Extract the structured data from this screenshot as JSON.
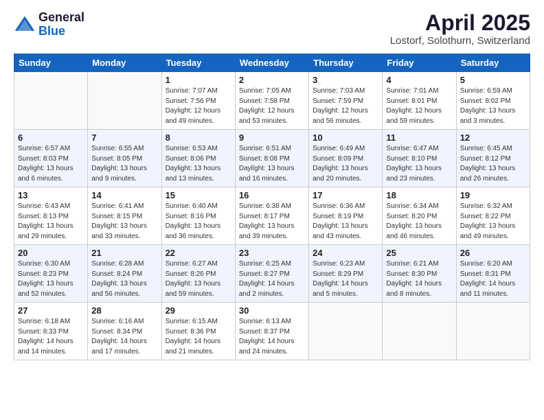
{
  "header": {
    "logo_general": "General",
    "logo_blue": "Blue",
    "month_title": "April 2025",
    "location": "Lostorf, Solothurn, Switzerland"
  },
  "weekdays": [
    "Sunday",
    "Monday",
    "Tuesday",
    "Wednesday",
    "Thursday",
    "Friday",
    "Saturday"
  ],
  "weeks": [
    [
      {
        "day": "",
        "info": ""
      },
      {
        "day": "",
        "info": ""
      },
      {
        "day": "1",
        "info": "Sunrise: 7:07 AM\nSunset: 7:56 PM\nDaylight: 12 hours and 49 minutes."
      },
      {
        "day": "2",
        "info": "Sunrise: 7:05 AM\nSunset: 7:58 PM\nDaylight: 12 hours and 53 minutes."
      },
      {
        "day": "3",
        "info": "Sunrise: 7:03 AM\nSunset: 7:59 PM\nDaylight: 12 hours and 56 minutes."
      },
      {
        "day": "4",
        "info": "Sunrise: 7:01 AM\nSunset: 8:01 PM\nDaylight: 12 hours and 59 minutes."
      },
      {
        "day": "5",
        "info": "Sunrise: 6:59 AM\nSunset: 8:02 PM\nDaylight: 13 hours and 3 minutes."
      }
    ],
    [
      {
        "day": "6",
        "info": "Sunrise: 6:57 AM\nSunset: 8:03 PM\nDaylight: 13 hours and 6 minutes."
      },
      {
        "day": "7",
        "info": "Sunrise: 6:55 AM\nSunset: 8:05 PM\nDaylight: 13 hours and 9 minutes."
      },
      {
        "day": "8",
        "info": "Sunrise: 6:53 AM\nSunset: 8:06 PM\nDaylight: 13 hours and 13 minutes."
      },
      {
        "day": "9",
        "info": "Sunrise: 6:51 AM\nSunset: 8:08 PM\nDaylight: 13 hours and 16 minutes."
      },
      {
        "day": "10",
        "info": "Sunrise: 6:49 AM\nSunset: 8:09 PM\nDaylight: 13 hours and 20 minutes."
      },
      {
        "day": "11",
        "info": "Sunrise: 6:47 AM\nSunset: 8:10 PM\nDaylight: 13 hours and 23 minutes."
      },
      {
        "day": "12",
        "info": "Sunrise: 6:45 AM\nSunset: 8:12 PM\nDaylight: 13 hours and 26 minutes."
      }
    ],
    [
      {
        "day": "13",
        "info": "Sunrise: 6:43 AM\nSunset: 8:13 PM\nDaylight: 13 hours and 29 minutes."
      },
      {
        "day": "14",
        "info": "Sunrise: 6:41 AM\nSunset: 8:15 PM\nDaylight: 13 hours and 33 minutes."
      },
      {
        "day": "15",
        "info": "Sunrise: 6:40 AM\nSunset: 8:16 PM\nDaylight: 13 hours and 36 minutes."
      },
      {
        "day": "16",
        "info": "Sunrise: 6:38 AM\nSunset: 8:17 PM\nDaylight: 13 hours and 39 minutes."
      },
      {
        "day": "17",
        "info": "Sunrise: 6:36 AM\nSunset: 8:19 PM\nDaylight: 13 hours and 43 minutes."
      },
      {
        "day": "18",
        "info": "Sunrise: 6:34 AM\nSunset: 8:20 PM\nDaylight: 13 hours and 46 minutes."
      },
      {
        "day": "19",
        "info": "Sunrise: 6:32 AM\nSunset: 8:22 PM\nDaylight: 13 hours and 49 minutes."
      }
    ],
    [
      {
        "day": "20",
        "info": "Sunrise: 6:30 AM\nSunset: 8:23 PM\nDaylight: 13 hours and 52 minutes."
      },
      {
        "day": "21",
        "info": "Sunrise: 6:28 AM\nSunset: 8:24 PM\nDaylight: 13 hours and 56 minutes."
      },
      {
        "day": "22",
        "info": "Sunrise: 6:27 AM\nSunset: 8:26 PM\nDaylight: 13 hours and 59 minutes."
      },
      {
        "day": "23",
        "info": "Sunrise: 6:25 AM\nSunset: 8:27 PM\nDaylight: 14 hours and 2 minutes."
      },
      {
        "day": "24",
        "info": "Sunrise: 6:23 AM\nSunset: 8:29 PM\nDaylight: 14 hours and 5 minutes."
      },
      {
        "day": "25",
        "info": "Sunrise: 6:21 AM\nSunset: 8:30 PM\nDaylight: 14 hours and 8 minutes."
      },
      {
        "day": "26",
        "info": "Sunrise: 6:20 AM\nSunset: 8:31 PM\nDaylight: 14 hours and 11 minutes."
      }
    ],
    [
      {
        "day": "27",
        "info": "Sunrise: 6:18 AM\nSunset: 8:33 PM\nDaylight: 14 hours and 14 minutes."
      },
      {
        "day": "28",
        "info": "Sunrise: 6:16 AM\nSunset: 8:34 PM\nDaylight: 14 hours and 17 minutes."
      },
      {
        "day": "29",
        "info": "Sunrise: 6:15 AM\nSunset: 8:36 PM\nDaylight: 14 hours and 21 minutes."
      },
      {
        "day": "30",
        "info": "Sunrise: 6:13 AM\nSunset: 8:37 PM\nDaylight: 14 hours and 24 minutes."
      },
      {
        "day": "",
        "info": ""
      },
      {
        "day": "",
        "info": ""
      },
      {
        "day": "",
        "info": ""
      }
    ]
  ]
}
